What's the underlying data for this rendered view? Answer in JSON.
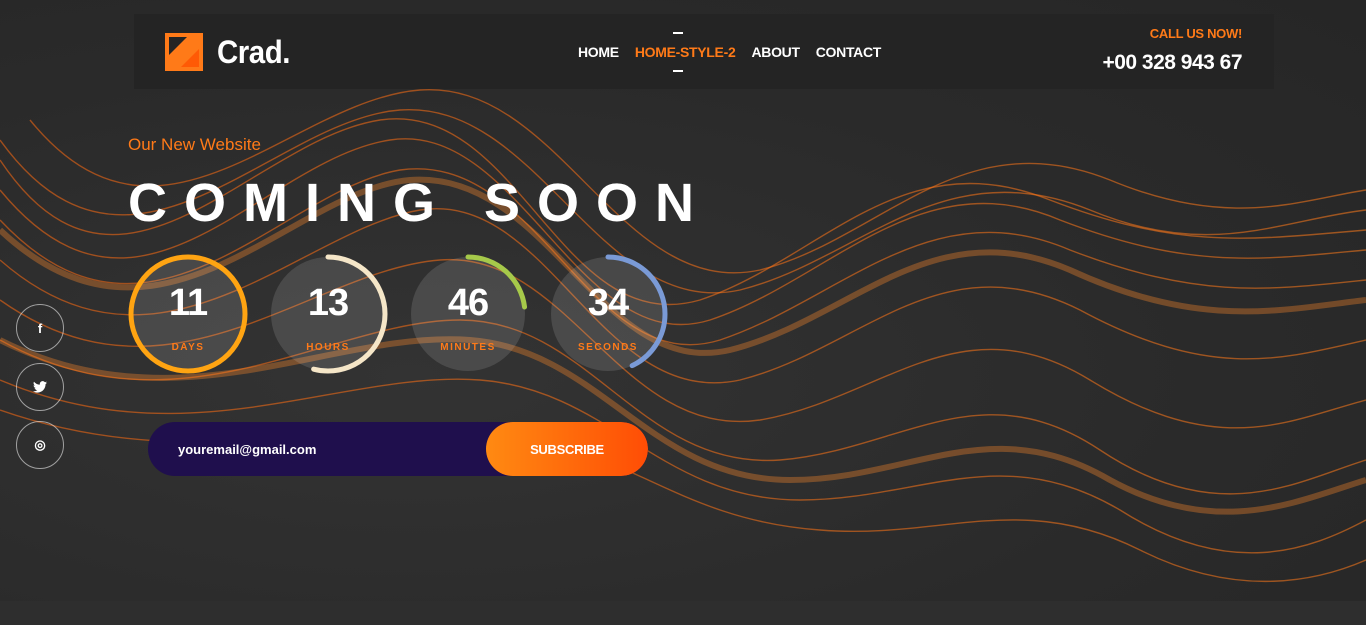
{
  "brand": {
    "name": "Crad.",
    "accent": "#ff7a18"
  },
  "nav": {
    "items": [
      {
        "label": "HOME"
      },
      {
        "label": "HOME-STYLE-2"
      },
      {
        "label": "ABOUT"
      },
      {
        "label": "CONTACT"
      }
    ],
    "active_index": 1
  },
  "contact": {
    "call_label": "CALL US NOW!",
    "phone": "+00 328 943 67"
  },
  "hero": {
    "tagline": "Our New Website",
    "headline": "COMING SOON"
  },
  "countdown": [
    {
      "value": "11",
      "label": "DAYS",
      "progress": 1.0,
      "color": "#ffa412"
    },
    {
      "value": "13",
      "label": "HOURS",
      "progress": 0.54,
      "color": "#f5e6c8"
    },
    {
      "value": "46",
      "label": "MINUTES",
      "progress": 0.23,
      "color": "#a6c94a"
    },
    {
      "value": "34",
      "label": "SECONDS",
      "progress": 0.43,
      "color": "#7a9ad6"
    }
  ],
  "social": [
    {
      "icon": "facebook-icon",
      "glyph": "f"
    },
    {
      "icon": "twitter-icon",
      "glyph": "t"
    },
    {
      "icon": "dribbble-icon",
      "glyph": "◎"
    }
  ],
  "subscribe": {
    "placeholder": "youremail@gmail.com",
    "button_label": "SUBSCRIBE"
  }
}
